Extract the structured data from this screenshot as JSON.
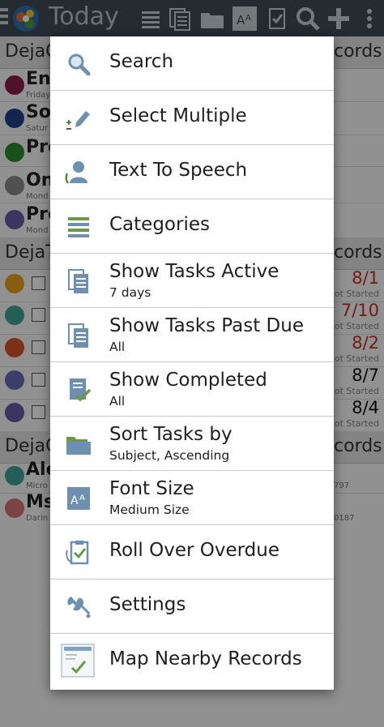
{
  "topbar": {
    "title": "Today"
  },
  "background": {
    "sections": [
      "DejaC",
      "DejaT",
      "DejaC"
    ],
    "sections_right": [
      "cords",
      "cords",
      "cords"
    ],
    "rows": [
      {
        "text": "Enc",
        "sub": "Friday"
      },
      {
        "text": "Soc",
        "sub": "Satur"
      },
      {
        "text": "Pre",
        "sub": ""
      },
      {
        "text": "On",
        "sub": "Mond"
      },
      {
        "text": "Pro",
        "sub": "Mond"
      }
    ],
    "tasks": [
      {
        "date": "8/1",
        "status": "Not Started"
      },
      {
        "date": "7/10",
        "status": "Not Started"
      },
      {
        "date": "8/2",
        "status": "Not Started"
      },
      {
        "date": "8/7",
        "status": "Not Started"
      },
      {
        "date": "8/4",
        "status": "Not Started"
      }
    ],
    "contacts": [
      {
        "text": "Ale",
        "sub": "Micro",
        "right": "797"
      },
      {
        "text": "Ms",
        "sub": "Darin",
        "right": "0187"
      }
    ]
  },
  "menu": [
    {
      "label": "Search",
      "sub": "",
      "icon": "search-icon"
    },
    {
      "label": "Select Multiple",
      "sub": "",
      "icon": "select-multiple-icon"
    },
    {
      "label": "Text To Speech",
      "sub": "",
      "icon": "text-to-speech-icon"
    },
    {
      "label": "Categories",
      "sub": "",
      "icon": "categories-icon"
    },
    {
      "label": "Show Tasks Active",
      "sub": "7 days",
      "icon": "tasks-active-icon"
    },
    {
      "label": "Show Tasks Past Due",
      "sub": "All",
      "icon": "tasks-past-due-icon"
    },
    {
      "label": "Show Completed",
      "sub": "All",
      "icon": "completed-icon"
    },
    {
      "label": "Sort Tasks by",
      "sub": "Subject, Ascending",
      "icon": "folder-icon"
    },
    {
      "label": "Font Size",
      "sub": "Medium Size",
      "icon": "font-size-icon"
    },
    {
      "label": "Roll Over Overdue",
      "sub": "",
      "icon": "roll-over-icon"
    },
    {
      "label": "Settings",
      "sub": "",
      "icon": "wrench-icon"
    },
    {
      "label": "Map Nearby Records",
      "sub": "",
      "icon": "map-icon"
    }
  ],
  "colors": {
    "topbar": "#3e4a55",
    "accent_icon": "#5e82a6",
    "overdue_red": "#c0302a"
  }
}
